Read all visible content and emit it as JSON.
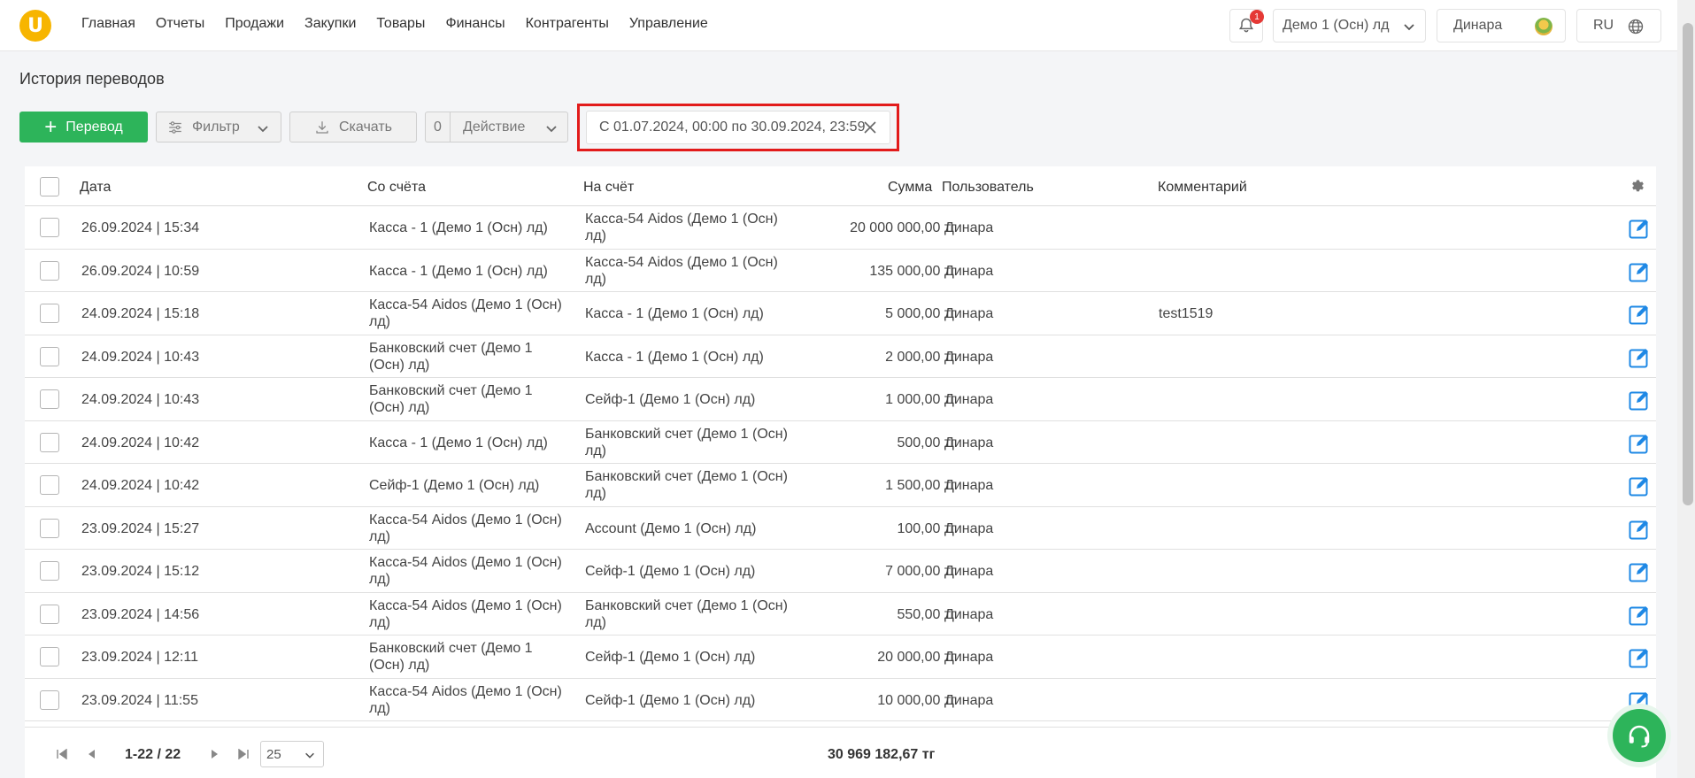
{
  "nav": {
    "items": [
      "Главная",
      "Отчеты",
      "Продажи",
      "Закупки",
      "Товары",
      "Финансы",
      "Контрагенты",
      "Управление"
    ]
  },
  "header": {
    "notifications_count": "1",
    "company": "Демо 1 (Осн) лд",
    "user": "Динара",
    "lang": "RU"
  },
  "page": {
    "title": "История переводов"
  },
  "toolbar": {
    "add_label": "Перевод",
    "filter_label": "Фильтр",
    "download_label": "Скачать",
    "action_count": "0",
    "action_label": "Действие",
    "date_range": "С 01.07.2024, 00:00 по 30.09.2024, 23:59"
  },
  "table": {
    "headers": {
      "date": "Дата",
      "from": "Со счёта",
      "to": "На счёт",
      "sum": "Сумма",
      "user": "Пользователь",
      "comment": "Комментарий"
    },
    "rows": [
      {
        "date": "26.09.2024 | 15:34",
        "from": "Касса - 1 (Демо 1 (Осн) лд)",
        "to": "Касса-54 Aidos (Демо 1 (Осн) лд)",
        "sum": "20 000 000,00 тг",
        "user": "Динара",
        "comment": ""
      },
      {
        "date": "26.09.2024 | 10:59",
        "from": "Касса - 1 (Демо 1 (Осн) лд)",
        "to": "Касса-54 Aidos (Демо 1 (Осн) лд)",
        "sum": "135 000,00 тг",
        "user": "Динара",
        "comment": ""
      },
      {
        "date": "24.09.2024 | 15:18",
        "from": "Касса-54 Aidos (Демо 1 (Осн) лд)",
        "to": "Касса - 1 (Демо 1 (Осн) лд)",
        "sum": "5 000,00 тг",
        "user": "Динара",
        "comment": "test1519"
      },
      {
        "date": "24.09.2024 | 10:43",
        "from": "Банковский счет (Демо 1 (Осн) лд)",
        "to": "Касса - 1 (Демо 1 (Осн) лд)",
        "sum": "2 000,00 тг",
        "user": "Динара",
        "comment": ""
      },
      {
        "date": "24.09.2024 | 10:43",
        "from": "Банковский счет (Демо 1 (Осн) лд)",
        "to": "Сейф-1 (Демо 1 (Осн) лд)",
        "sum": "1 000,00 тг",
        "user": "Динара",
        "comment": ""
      },
      {
        "date": "24.09.2024 | 10:42",
        "from": "Касса - 1 (Демо 1 (Осн) лд)",
        "to": "Банковский счет (Демо 1 (Осн) лд)",
        "sum": "500,00 тг",
        "user": "Динара",
        "comment": ""
      },
      {
        "date": "24.09.2024 | 10:42",
        "from": "Сейф-1 (Демо 1 (Осн) лд)",
        "to": "Банковский счет (Демо 1 (Осн) лд)",
        "sum": "1 500,00 тг",
        "user": "Динара",
        "comment": ""
      },
      {
        "date": "23.09.2024 | 15:27",
        "from": "Касса-54 Aidos (Демо 1 (Осн) лд)",
        "to": "Account (Демо 1 (Осн) лд)",
        "sum": "100,00 тг",
        "user": "Динара",
        "comment": ""
      },
      {
        "date": "23.09.2024 | 15:12",
        "from": "Касса-54 Aidos (Демо 1 (Осн) лд)",
        "to": "Сейф-1 (Демо 1 (Осн) лд)",
        "sum": "7 000,00 тг",
        "user": "Динара",
        "comment": ""
      },
      {
        "date": "23.09.2024 | 14:56",
        "from": "Касса-54 Aidos (Демо 1 (Осн) лд)",
        "to": "Банковский счет (Демо 1 (Осн) лд)",
        "sum": "550,00 тг",
        "user": "Динара",
        "comment": ""
      },
      {
        "date": "23.09.2024 | 12:11",
        "from": "Банковский счет (Демо 1 (Осн) лд)",
        "to": "Сейф-1 (Демо 1 (Осн) лд)",
        "sum": "20 000,00 тг",
        "user": "Динара",
        "comment": ""
      },
      {
        "date": "23.09.2024 | 11:55",
        "from": "Касса-54 Aidos (Демо 1 (Осн) лд)",
        "to": "Сейф-1 (Демо 1 (Осн) лд)",
        "sum": "10 000,00 тг",
        "user": "Динара",
        "comment": ""
      }
    ]
  },
  "footer": {
    "range": "1-22 / 22",
    "page_size": "25",
    "total": "30 969 182,67 тг"
  },
  "colors": {
    "accent_green": "#2db45a",
    "highlight_red": "#e21b1b",
    "edit_blue": "#1e88e5",
    "logo_yellow": "#f7b500"
  }
}
